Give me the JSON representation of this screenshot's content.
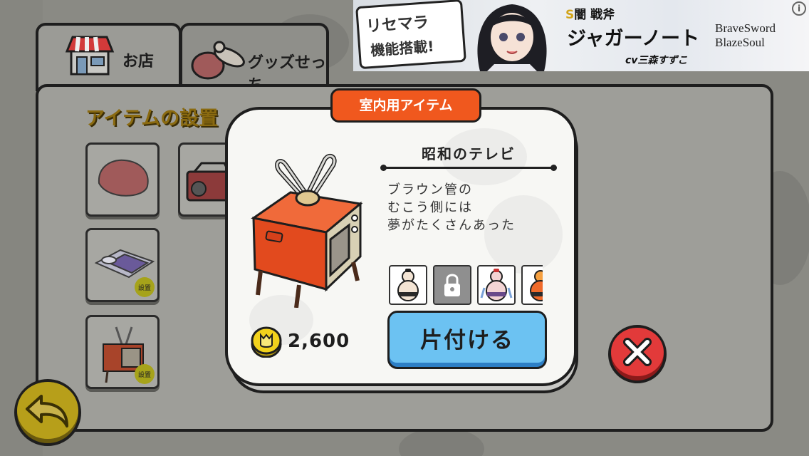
{
  "tabs": {
    "shop": "お店",
    "goods": "グッズせっち"
  },
  "panel": {
    "title": "アイテムの設置",
    "slot_badge": "設置"
  },
  "ad": {
    "bubble_line1": "リセマラ",
    "bubble_line2": "機能搭載!",
    "subtitle_s": "S",
    "subtitle_rest": "闇 戦斧",
    "name": "ジャガーノート",
    "cv": "cv三森すずこ",
    "logo_line1": "BraveSword",
    "logo_line2": "BlazeSoul",
    "info_icon": "i"
  },
  "dialog": {
    "category": "室内用アイテム",
    "item_name": "昭和のテレビ",
    "description": [
      "ブラウン管の",
      "むこう側には",
      "夢がたくさんあった"
    ],
    "price": "2,600",
    "action_label": "片付ける"
  },
  "colors": {
    "category_bg": "#f0581e",
    "action_bg": "#6cc2f2",
    "close_bg": "#e23a3a",
    "coin": "#f2d21c"
  }
}
